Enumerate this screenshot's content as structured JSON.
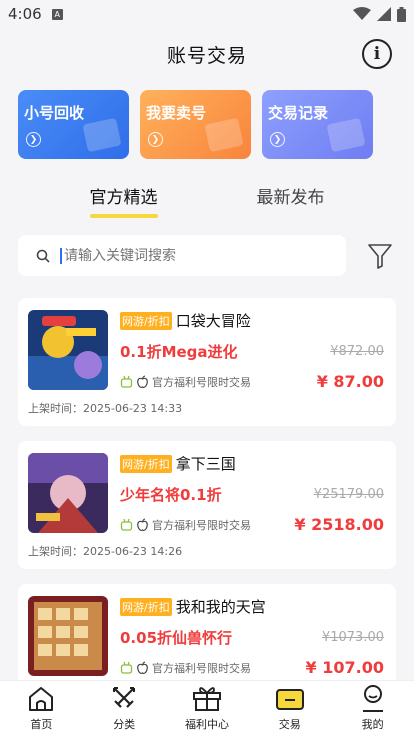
{
  "status": {
    "time": "4:06",
    "a_icon": "A"
  },
  "nav": {
    "title": "账号交易",
    "info_glyph": "i"
  },
  "tiles": [
    {
      "label": "小号回收",
      "color": "#3a7bf2"
    },
    {
      "label": "我要卖号",
      "color": "#fa9a48"
    },
    {
      "label": "交易记录",
      "color": "#7e8ef7"
    }
  ],
  "tabs": [
    {
      "label": "官方精选",
      "active": true
    },
    {
      "label": "最新发布",
      "active": false
    }
  ],
  "search": {
    "placeholder": "请输入关键词搜索"
  },
  "listings": [
    {
      "tag": "网游/折扣",
      "game": "口袋大冒险",
      "deal": "0.1折Mega进化",
      "orig_price": "¥872.00",
      "platform_text": "官方福利号限时交易",
      "price": "¥ 87.00",
      "time": "上架时间：2025-06-23 14:33"
    },
    {
      "tag": "网游/折扣",
      "game": "拿下三国",
      "deal": "少年名将0.1折",
      "orig_price": "¥25179.00",
      "platform_text": "官方福利号限时交易",
      "price": "¥ 2518.00",
      "time": "上架时间：2025-06-23 14:26"
    },
    {
      "tag": "网游/折扣",
      "game": "我和我的天宫",
      "deal": "0.05折仙兽怀行",
      "orig_price": "¥1073.00",
      "platform_text": "官方福利号限时交易",
      "price": "¥ 107.00",
      "time": ""
    }
  ],
  "tabbar": [
    {
      "label": "首页",
      "icon": "home-icon"
    },
    {
      "label": "分类",
      "icon": "swords-icon"
    },
    {
      "label": "福利中心",
      "icon": "gift-icon"
    },
    {
      "label": "交易",
      "icon": "wallet-icon"
    },
    {
      "label": "我的",
      "icon": "user-icon"
    }
  ],
  "colors": {
    "accent": "#f7d83c",
    "price_red": "#f03c3c",
    "tag_orange": "#ffb020"
  }
}
